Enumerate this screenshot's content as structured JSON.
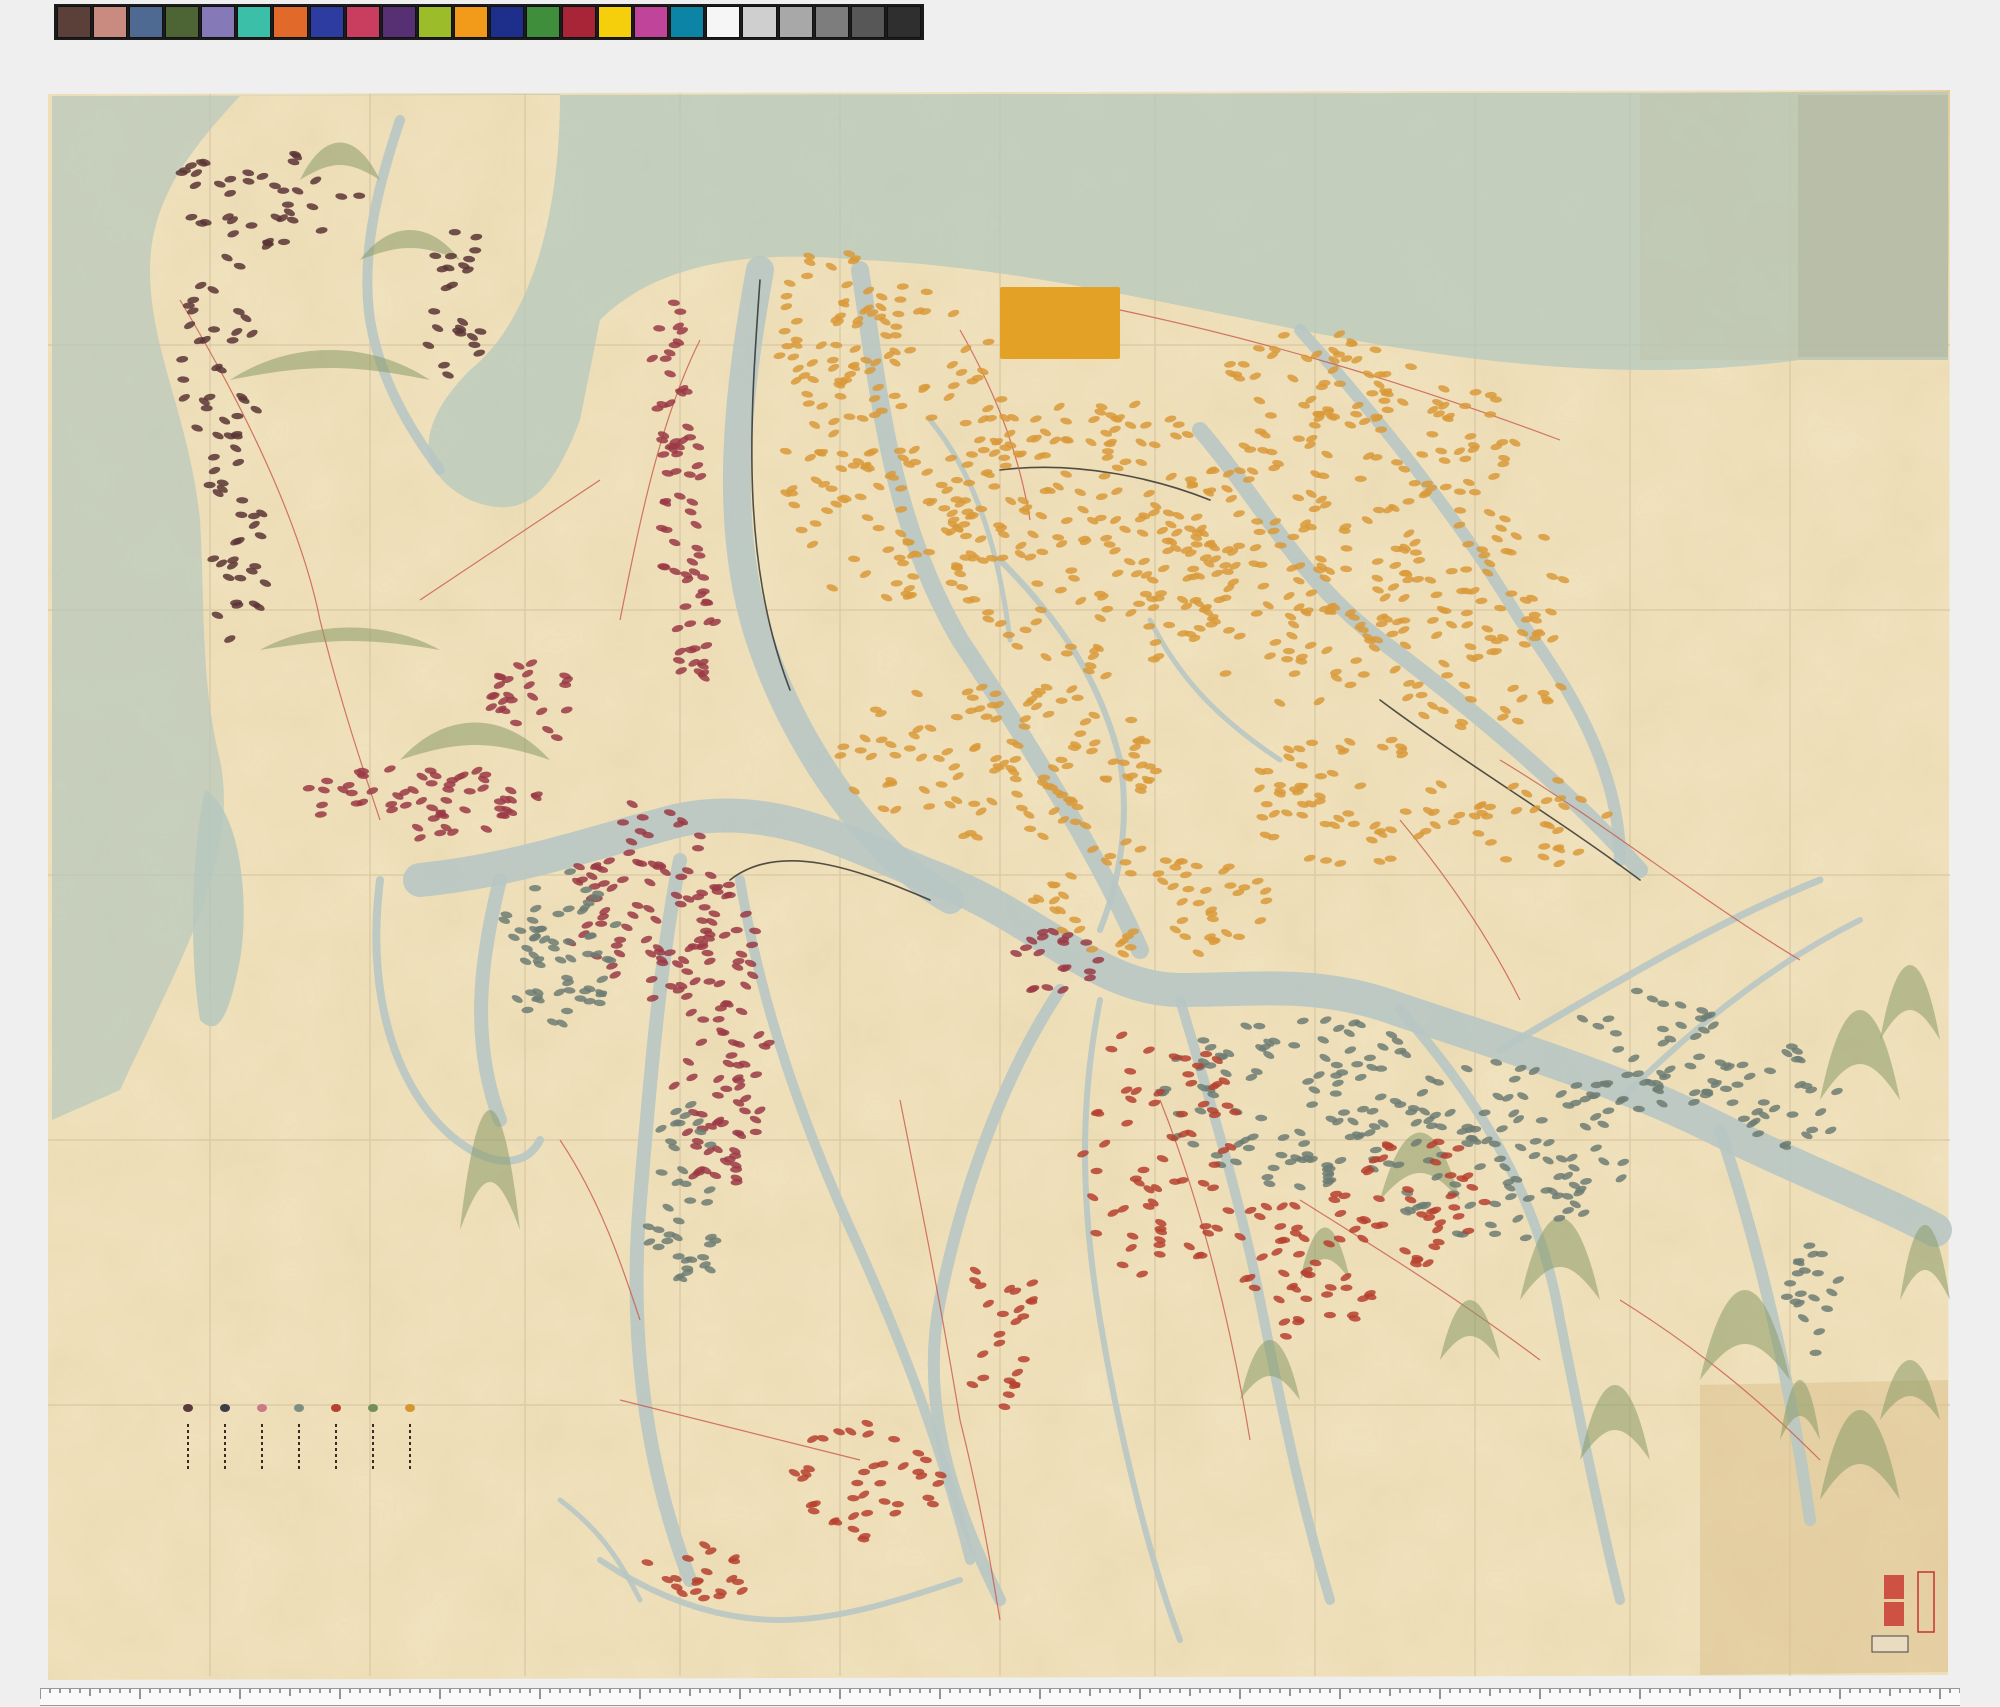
{
  "colorbar": {
    "patches": [
      "#5a4038",
      "#c98a7f",
      "#4e6a93",
      "#4d6535",
      "#8679b8",
      "#3bbfa8",
      "#e16a2b",
      "#2c3ca0",
      "#c93e5e",
      "#563073",
      "#9cbc2a",
      "#f29a1a",
      "#1d2f8a",
      "#3f8e3c",
      "#a72536",
      "#f5cf0b",
      "#c0449a",
      "#0c84a5",
      "#f6f6f6",
      "#cfcfcf",
      "#a8a8a8",
      "#7d7d7d",
      "#575757",
      "#2f2f2f"
    ]
  },
  "map": {
    "paper_color": "#f1e3bf",
    "sea_color": "#b6c8bd",
    "river_color": "#b7c7c3",
    "label_color": "#e3a126"
  },
  "legend": {
    "items": [
      {
        "color": "#5a3a3a"
      },
      {
        "color": "#3d3f48"
      },
      {
        "color": "#c97a86"
      },
      {
        "color": "#7f8d83"
      },
      {
        "color": "#b6412f"
      },
      {
        "color": "#748e59"
      },
      {
        "color": "#d79532"
      }
    ]
  }
}
